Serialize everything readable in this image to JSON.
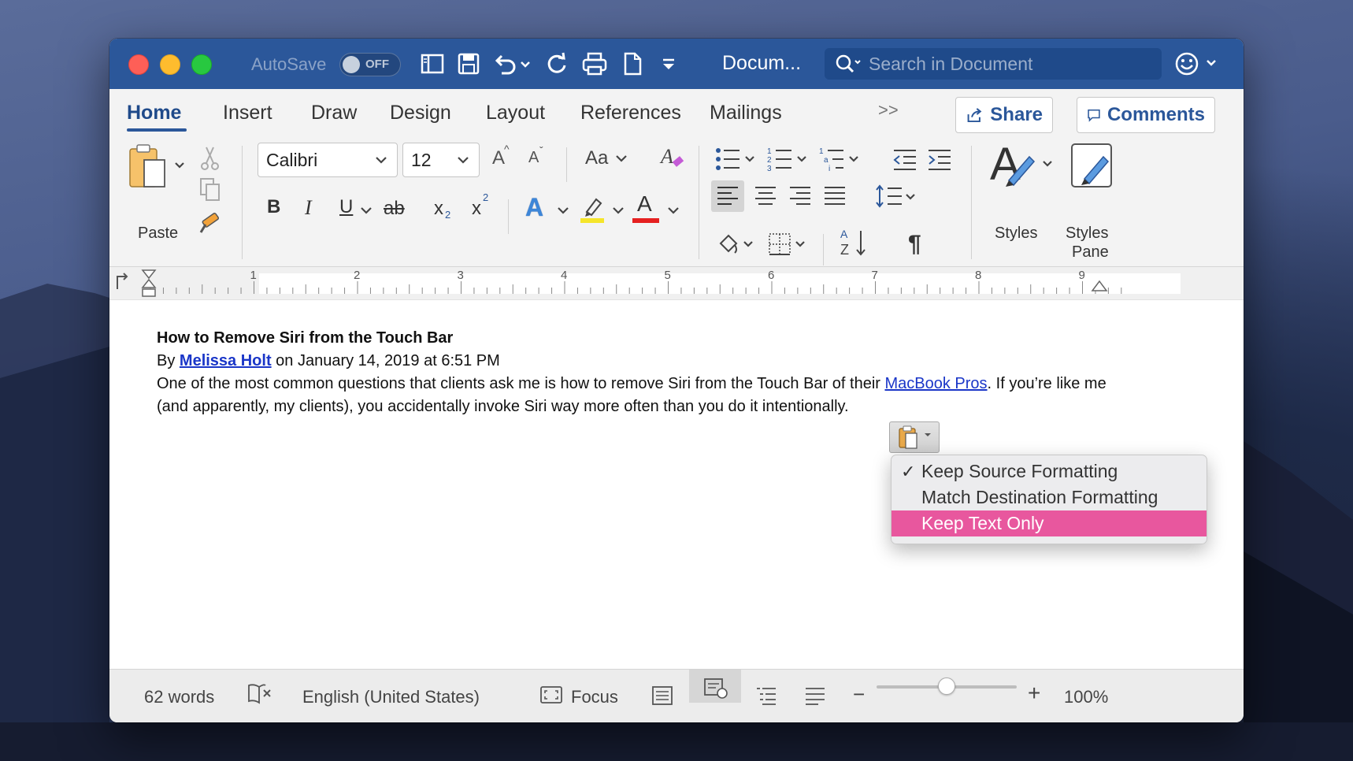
{
  "window": {
    "autosave_label": "AutoSave",
    "autosave_state": "OFF",
    "doc_title": "Docum...",
    "search_placeholder": "Search in Document"
  },
  "tabs": [
    {
      "label": "Home",
      "active": true
    },
    {
      "label": "Insert"
    },
    {
      "label": "Draw"
    },
    {
      "label": "Design"
    },
    {
      "label": "Layout"
    },
    {
      "label": "References"
    },
    {
      "label": "Mailings"
    }
  ],
  "more_tabs": ">>",
  "actions": {
    "share": "Share",
    "comments": "Comments"
  },
  "ribbon": {
    "paste_label": "Paste",
    "font_name": "Calibri",
    "font_size": "12",
    "grow_font": "A",
    "shrink_font": "A",
    "change_case": "Aa",
    "bold": "B",
    "italic": "I",
    "underline": "U",
    "strikethrough": "ab",
    "subscript": "x",
    "subscript_mark": "2",
    "superscript": "x",
    "superscript_mark": "2",
    "text_effects": "A",
    "font_color": "A",
    "pilcrow": "¶",
    "sort_a": "A",
    "sort_z": "Z",
    "styles_glyph": "A",
    "styles_label": "Styles",
    "styles_pane_label_1": "Styles",
    "styles_pane_label_2": "Pane"
  },
  "ruler": [
    "1",
    "2",
    "3",
    "4",
    "5",
    "6",
    "7",
    "8",
    "9"
  ],
  "document": {
    "heading": "How to Remove Siri from the Touch Bar",
    "byline_prefix": "By ",
    "author": "Melissa Holt",
    "byline_suffix": " on January 14, 2019 at 6:51 PM",
    "body_part1": "One of the most common questions that clients ask me is how to remove Siri from the Touch Bar of their ",
    "body_link": "MacBook Pros",
    "body_part2": ". If you’re like me (and apparently, my clients), you accidentally invoke Siri way more often than you do it intentionally."
  },
  "paste_menu": {
    "checkmark": "✓",
    "items": [
      {
        "label": "Keep Source Formatting",
        "checked": true
      },
      {
        "label": "Match Destination Formatting"
      },
      {
        "label": "Keep Text Only",
        "highlighted": true
      }
    ]
  },
  "status": {
    "word_count": "62 words",
    "language": "English (United States)",
    "focus": "Focus",
    "zoom_minus": "−",
    "zoom_plus": "+",
    "zoom": "100%",
    "zoom_slider_fraction": 0.5
  },
  "colors": {
    "titlebar": "#2b579a",
    "accent": "#2b579a",
    "highlight_menu": "#e8579e",
    "link": "#1a36c8",
    "highlight_yellow": "#f5e52a",
    "font_red": "#e52020"
  }
}
